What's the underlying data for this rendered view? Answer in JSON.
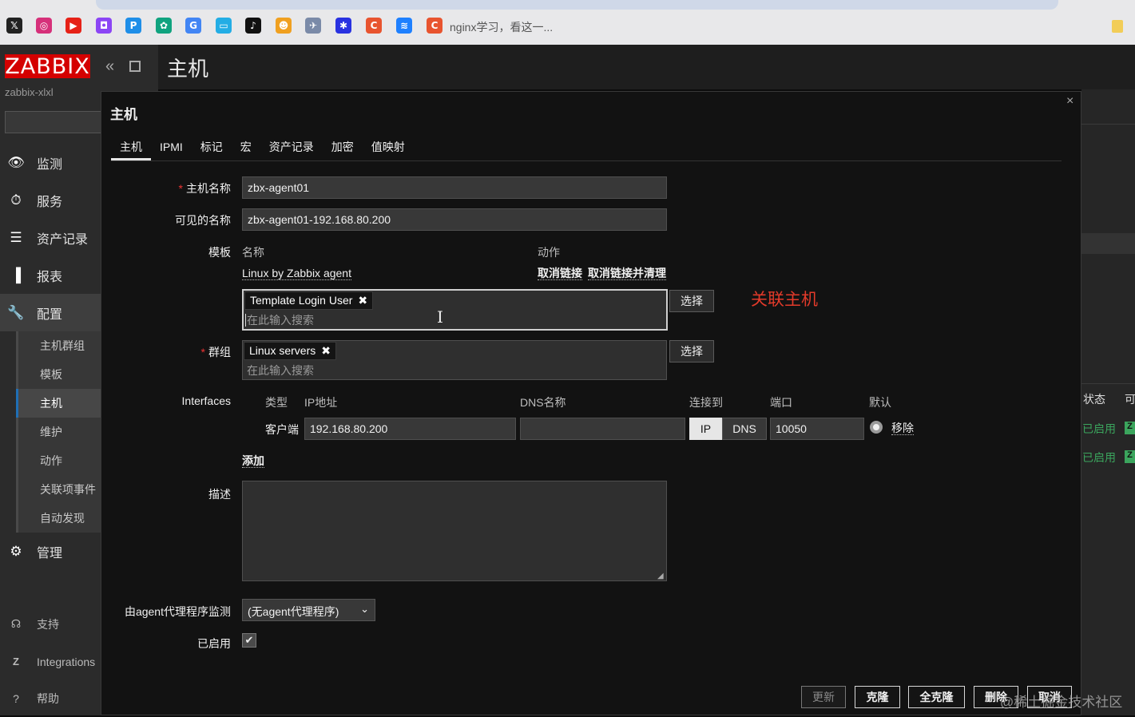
{
  "browser": {
    "bookmarks": [
      {
        "icon": "x-icon",
        "glyph": "𝕏",
        "color": "#222222"
      },
      {
        "icon": "instagram-icon",
        "glyph": "◎",
        "color": "#d6307a"
      },
      {
        "icon": "youtube-icon",
        "glyph": "▶",
        "color": "#e62117"
      },
      {
        "icon": "twitch-icon",
        "glyph": "◘",
        "color": "#8b45f5"
      },
      {
        "icon": "pixiv-icon",
        "glyph": "P",
        "color": "#1e8ee8"
      },
      {
        "icon": "chatgpt-icon",
        "glyph": "✿",
        "color": "#10a37f"
      },
      {
        "icon": "google-icon",
        "glyph": "G",
        "color": "#4285f4"
      },
      {
        "icon": "bilibili-icon",
        "glyph": "▭",
        "color": "#23ade5"
      },
      {
        "icon": "tiktok-icon",
        "glyph": "♪",
        "color": "#111111"
      },
      {
        "icon": "duck-icon",
        "glyph": "☻",
        "color": "#f0a020"
      },
      {
        "icon": "paper-plane-icon",
        "glyph": "✈",
        "color": "#7a8aa8"
      },
      {
        "icon": "baidu-icon",
        "glyph": "✱",
        "color": "#2932e1"
      },
      {
        "icon": "csdn-icon",
        "glyph": "C",
        "color": "#e8542f"
      },
      {
        "icon": "juejin-icon",
        "glyph": "≋",
        "color": "#1e80ff"
      },
      {
        "icon": "csdn-icon",
        "glyph": "C",
        "color": "#e8542f"
      }
    ],
    "bookmark_text": "nginx学习，看这一..."
  },
  "sidebar": {
    "logo": "ZABBIX",
    "server_name": "zabbix-xlxl",
    "collapse_glyph": "«",
    "menu": [
      {
        "label": "监测",
        "icon": "eye-icon",
        "glyph": "👁"
      },
      {
        "label": "服务",
        "icon": "stopwatch-icon",
        "glyph": "⏱"
      },
      {
        "label": "资产记录",
        "icon": "list-icon",
        "glyph": "☰"
      },
      {
        "label": "报表",
        "icon": "bar-chart-icon",
        "glyph": "▐"
      },
      {
        "label": "配置",
        "icon": "wrench-icon",
        "glyph": "🔧"
      }
    ],
    "submenu": [
      "主机群组",
      "模板",
      "主机",
      "维护",
      "动作",
      "关联项事件",
      "自动发现"
    ],
    "admin": {
      "label": "管理",
      "icon": "gear-icon",
      "glyph": "⚙"
    },
    "bottom": [
      {
        "label": "支持",
        "icon": "headset-icon",
        "glyph": "☊"
      },
      {
        "label": "Integrations",
        "icon": "zabbix-z-icon",
        "glyph": "Z"
      },
      {
        "label": "帮助",
        "icon": "help-icon",
        "glyph": "?"
      }
    ]
  },
  "page": {
    "title": "主机"
  },
  "background_table": {
    "status_header": "状态",
    "avail_header": "可",
    "rows": [
      "已启用",
      "已启用"
    ],
    "z_badge": "Z"
  },
  "dialog": {
    "title": "主机",
    "close": "×",
    "tabs": [
      "主机",
      "IPMI",
      "标记",
      "宏",
      "资产记录",
      "加密",
      "值映射"
    ],
    "host_name_label": "主机名称",
    "host_name_value": "zbx-agent01",
    "visible_name_label": "可见的名称",
    "visible_name_value": "zbx-agent01-192.168.80.200",
    "templates_label": "模板",
    "templates_col_name": "名称",
    "templates_col_action": "动作",
    "linked_template": "Linux by Zabbix agent",
    "unlink": "取消链接",
    "unlink_clear": "取消链接并清理",
    "new_template_chip": "Template Login User",
    "chip_remove": "✖",
    "search_placeholder": "在此输入搜索",
    "select_button": "选择",
    "annotation": "关联主机",
    "groups_label": "群组",
    "group_chip": "Linux servers",
    "interfaces_label": "Interfaces",
    "if_col_type": "类型",
    "if_col_ip": "IP地址",
    "if_col_dns": "DNS名称",
    "if_col_connect": "连接到",
    "if_col_port": "端口",
    "if_col_default": "默认",
    "if_type": "客户端",
    "if_ip": "192.168.80.200",
    "if_dns": "",
    "connect_ip": "IP",
    "connect_dns": "DNS",
    "if_port": "10050",
    "if_remove": "移除",
    "add_link": "添加",
    "description_label": "描述",
    "proxy_label": "由agent代理程序监测",
    "proxy_value": "(无agent代理程序)",
    "enabled_label": "已启用",
    "enabled_checked": true,
    "buttons": {
      "update": "更新",
      "clone": "克隆",
      "full_clone": "全克隆",
      "delete": "删除",
      "cancel": "取消"
    }
  },
  "watermark": "@稀土掘金技术社区"
}
